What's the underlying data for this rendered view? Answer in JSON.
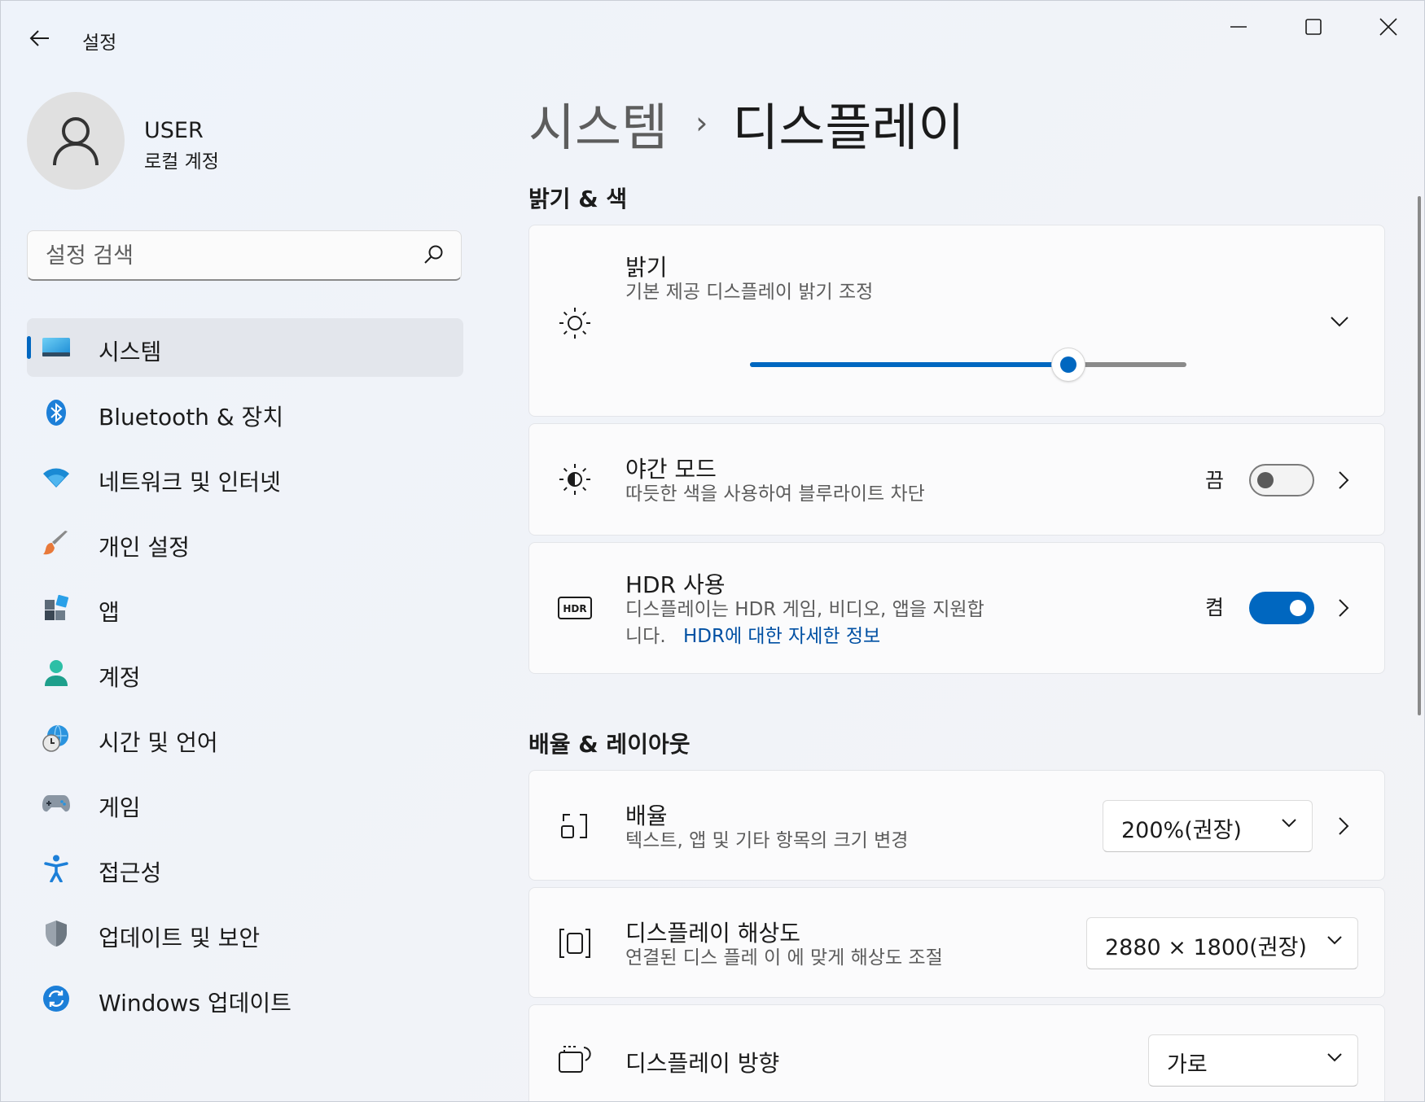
{
  "window": {
    "title": "설정",
    "back_icon": "arrow-left-icon"
  },
  "user": {
    "name": "USER",
    "account": "로컬 계정"
  },
  "search": {
    "placeholder": "설정 검색"
  },
  "nav": [
    {
      "label": "시스템",
      "icon": "system-icon",
      "active": true
    },
    {
      "label": "Bluetooth & 장치",
      "icon": "bluetooth-icon"
    },
    {
      "label": "네트워크 및 인터넷",
      "icon": "wifi-icon"
    },
    {
      "label": "개인 설정",
      "icon": "brush-icon"
    },
    {
      "label": "앱",
      "icon": "apps-icon"
    },
    {
      "label": "계정",
      "icon": "account-icon"
    },
    {
      "label": "시간 및 언어",
      "icon": "time-language-icon"
    },
    {
      "label": "게임",
      "icon": "gamepad-icon"
    },
    {
      "label": "접근성",
      "icon": "accessibility-icon"
    },
    {
      "label": "업데이트 및 보안",
      "icon": "shield-icon"
    },
    {
      "label": "Windows 업데이트",
      "icon": "update-icon"
    }
  ],
  "breadcrumb": {
    "parent": "시스템",
    "separator": "›",
    "current": "디스플레이"
  },
  "sections": {
    "brightness_color": "밝기 & 색",
    "scale_layout": "배율 & 레이아웃"
  },
  "brightness": {
    "title": "밝기",
    "subtitle": "기본 제공 디스플레이 밝기 조정",
    "level": 0.73
  },
  "night_light": {
    "title": "야간 모드",
    "subtitle": "따듯한 색을 사용하여 블루라이트 차단",
    "state": "끔",
    "on": false
  },
  "hdr": {
    "title": "HDR 사용",
    "subtitle_line1": "디스플레이는 HDR 게임, 비디오, 앱을 지원합",
    "subtitle_line2": "니다.",
    "link": "HDR에 대한 자세한 정보",
    "state": "켬",
    "on": true
  },
  "scale": {
    "title": "배율",
    "subtitle": "텍스트, 앱 및 기타 항목의 크기 변경",
    "value": "200%(권장)"
  },
  "resolution": {
    "title": "디스플레이 해상도",
    "subtitle": "연결된 디스 플레 이 에 맞게 해상도 조절",
    "value": "2880 × 1800(권장)"
  },
  "orientation": {
    "title": "디스플레이 방향",
    "value": "가로"
  },
  "colors": {
    "accent": "#0067c0",
    "link": "#0050a3"
  }
}
